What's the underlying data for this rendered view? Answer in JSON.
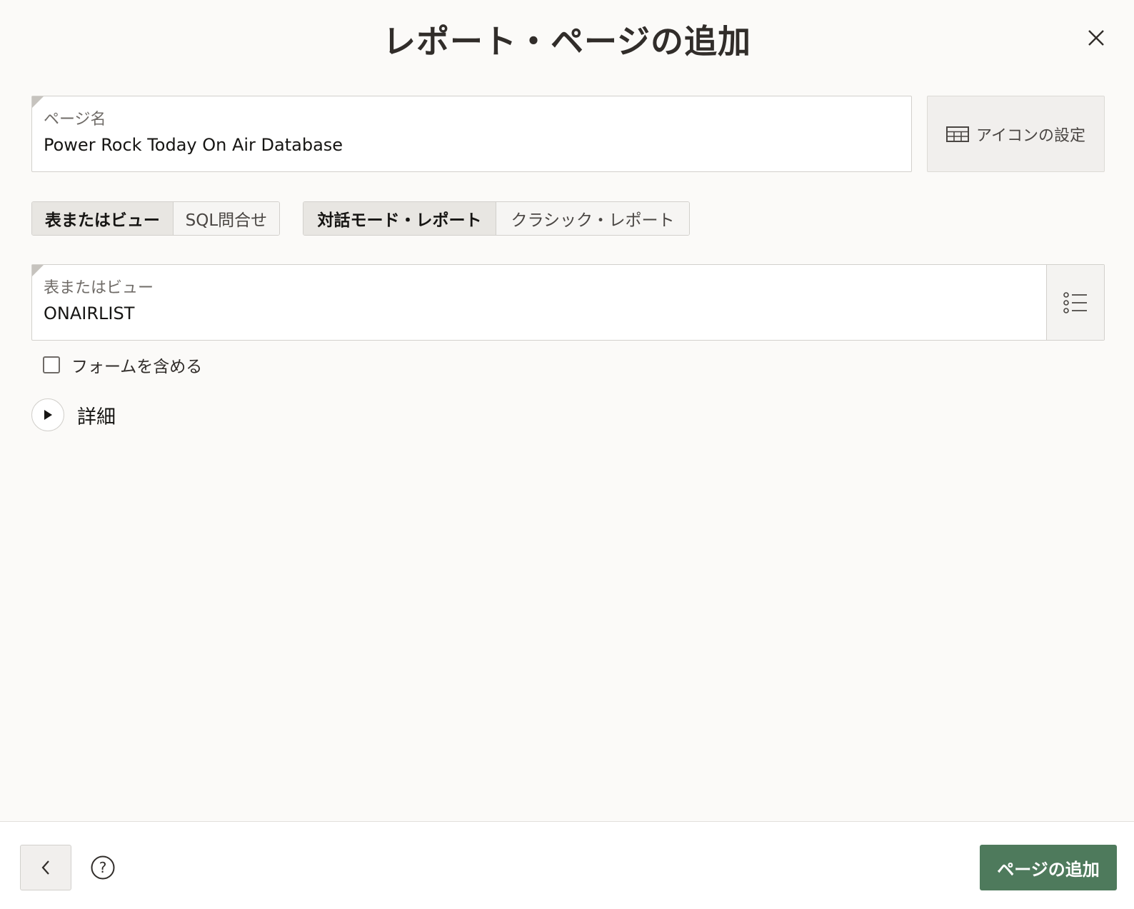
{
  "dialog": {
    "title": "レポート・ページの追加"
  },
  "page_name": {
    "label": "ページ名",
    "value": "Power Rock Today On Air Database"
  },
  "icon_button": {
    "label": "アイコンの設定",
    "icon": "table-grid-icon"
  },
  "source_toggle": {
    "options": [
      "表またはビュー",
      "SQL問合せ"
    ],
    "selected": "表またはビュー"
  },
  "report_type_toggle": {
    "options": [
      "対話モード・レポート",
      "クラシック・レポート"
    ],
    "selected": "対話モード・レポート"
  },
  "table_field": {
    "label": "表またはビュー",
    "value": "ONAIRLIST",
    "lov_icon": "list-icon"
  },
  "include_form": {
    "label": "フォームを含める",
    "checked": false
  },
  "details": {
    "label": "詳細",
    "expanded": false
  },
  "footer": {
    "primary_label": "ページの追加",
    "back_icon": "chevron-left-icon",
    "help_icon": "help-icon"
  },
  "colors": {
    "primary": "#4e7a5c",
    "background": "#fbfaf8"
  }
}
